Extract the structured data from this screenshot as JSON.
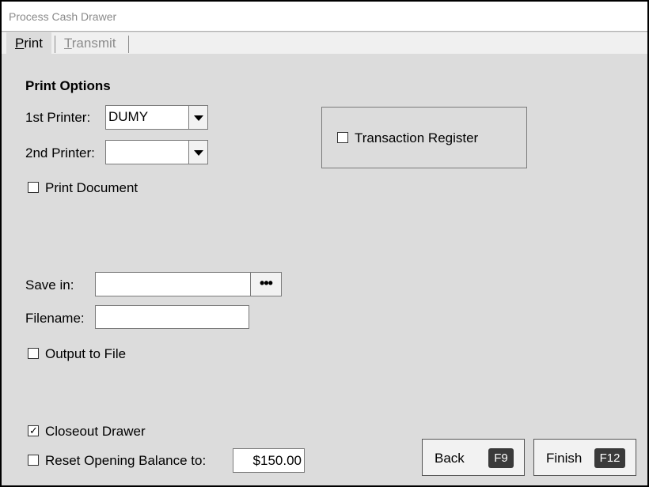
{
  "window": {
    "title": "Process Cash Drawer"
  },
  "tabs": [
    {
      "label": "Print",
      "accel": "P",
      "rest": "rint",
      "active": true
    },
    {
      "label": "Transmit",
      "accel": "T",
      "rest": "ransmit",
      "active": false
    }
  ],
  "print_options": {
    "section_title": "Print Options",
    "printer1": {
      "label": "1st Printer:",
      "value": "DUMY"
    },
    "printer2": {
      "label": "2nd Printer:",
      "value": ""
    },
    "print_document": {
      "label": "Print Document",
      "checked": false
    },
    "transaction_register": {
      "label": "Transaction Register",
      "checked": false
    }
  },
  "file_output": {
    "save_in": {
      "label": "Save in:",
      "value": "",
      "browse_label": "•••"
    },
    "filename": {
      "label": "Filename:",
      "value": ""
    },
    "output_to_file": {
      "label": "Output to File",
      "checked": false
    }
  },
  "closeout": {
    "closeout_drawer": {
      "label": "Closeout Drawer",
      "checked": true,
      "mark": "✓"
    },
    "reset_balance": {
      "label": "Reset Opening Balance to:",
      "checked": false,
      "value": "$150.00"
    }
  },
  "buttons": {
    "back": {
      "label": "Back",
      "key": "F9"
    },
    "finish": {
      "label": "Finish",
      "key": "F12"
    }
  }
}
